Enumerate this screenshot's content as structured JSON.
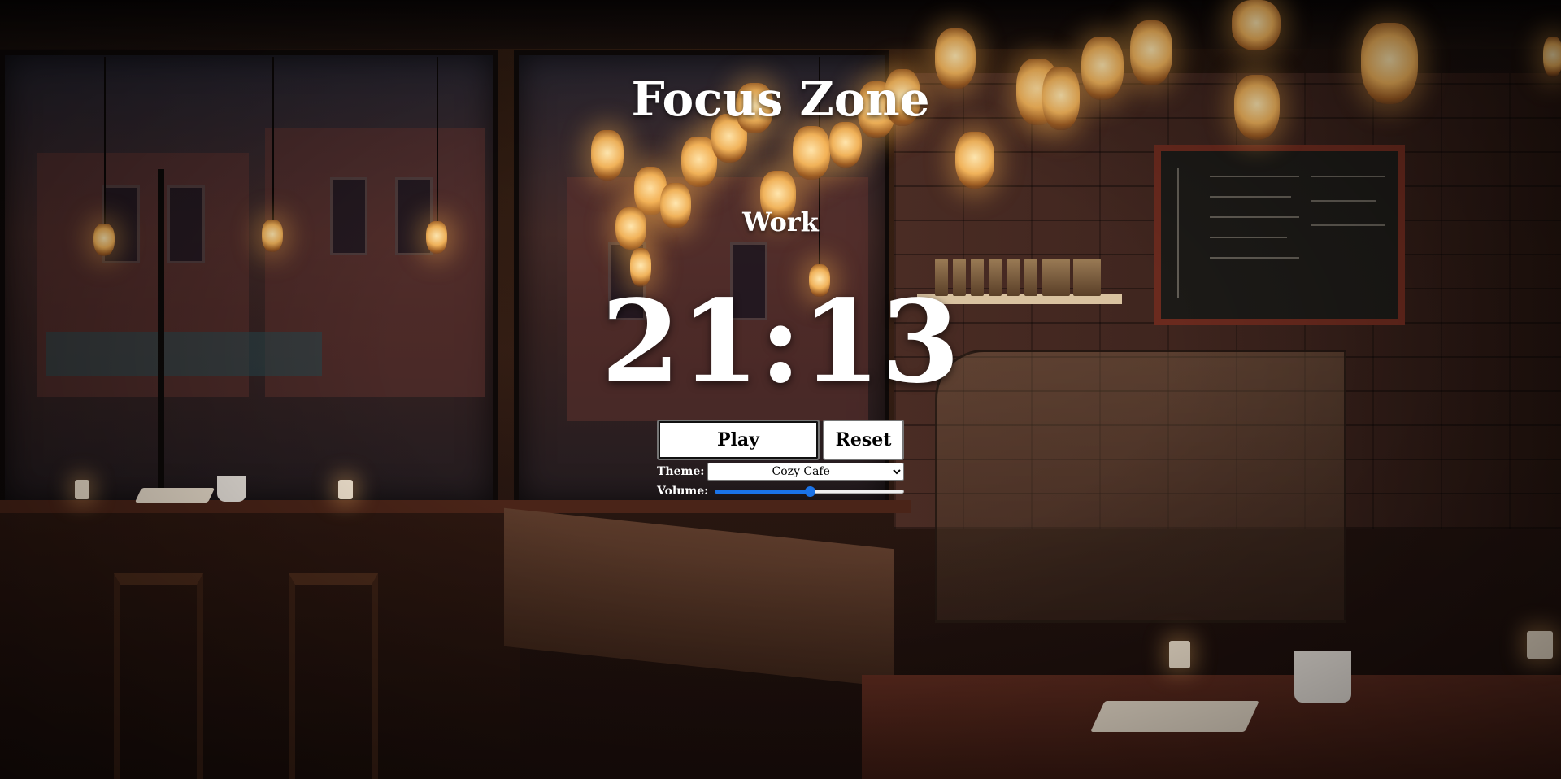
{
  "app": {
    "title": "Focus Zone",
    "mode": "Work",
    "timer": "21:13"
  },
  "controls": {
    "play_label": "Play",
    "reset_label": "Reset",
    "theme_label": "Theme:",
    "theme_selected": "Cozy Cafe",
    "volume_label": "Volume:",
    "volume_value": 0.5
  },
  "colors": {
    "text": "#ffffff",
    "slider_accent": "#1a73e8"
  }
}
